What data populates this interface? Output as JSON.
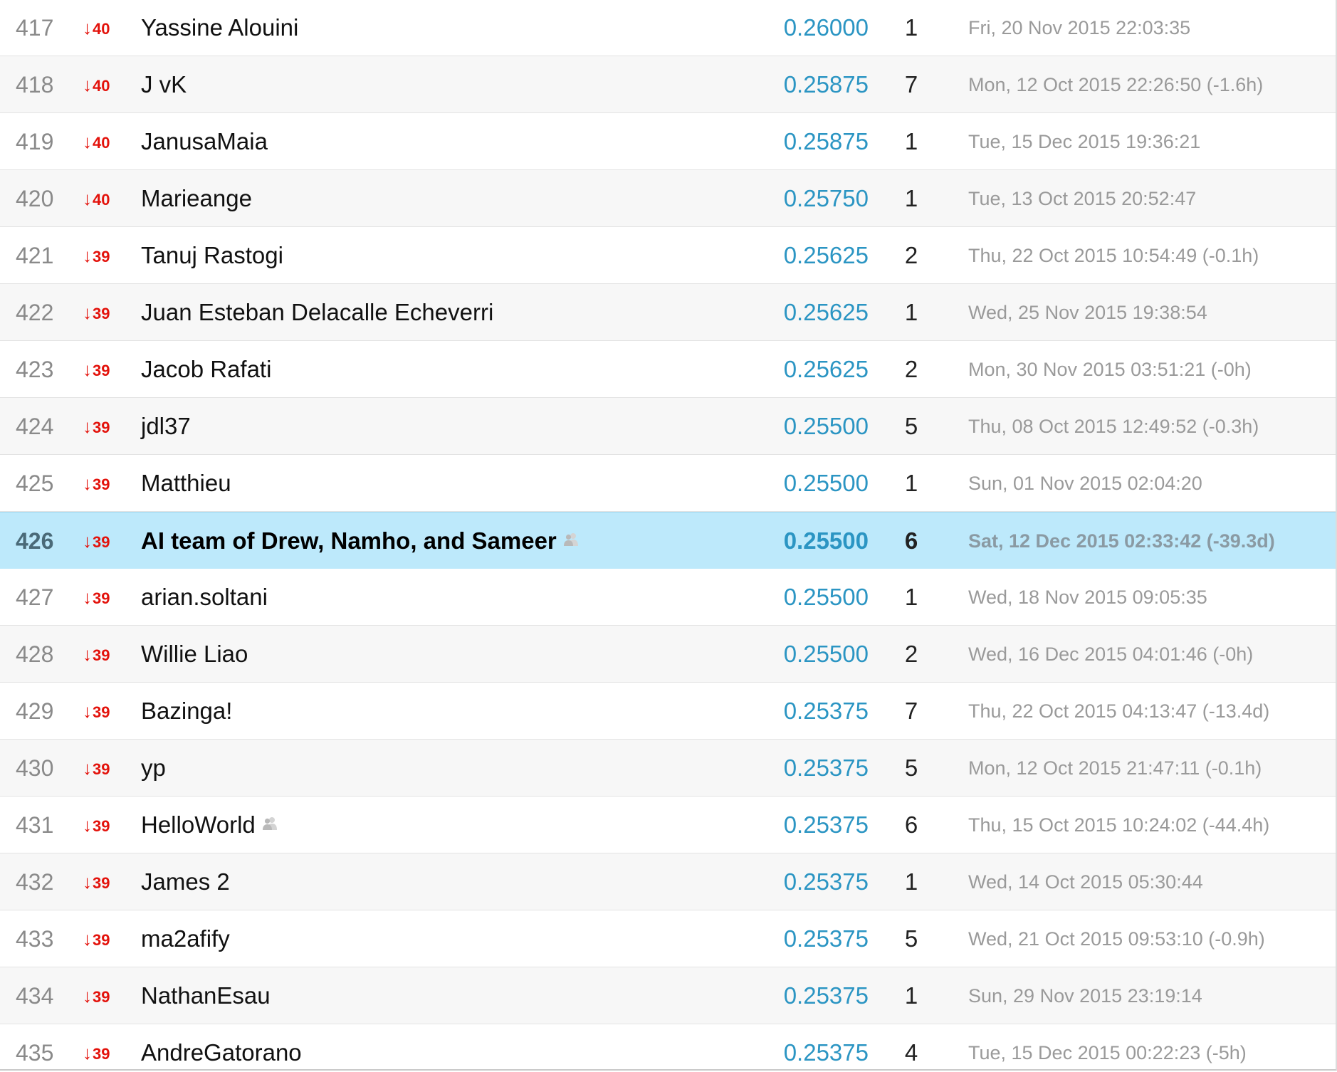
{
  "rows": [
    {
      "rank": "417",
      "change": "40",
      "team": "Yassine Alouini",
      "score": "0.26000",
      "entries": "1",
      "last": "Fri, 20 Nov 2015 22:03:35",
      "team_icon": false,
      "highlight": false
    },
    {
      "rank": "418",
      "change": "40",
      "team": "J vK",
      "score": "0.25875",
      "entries": "7",
      "last": "Mon, 12 Oct 2015 22:26:50 (-1.6h)",
      "team_icon": false,
      "highlight": false
    },
    {
      "rank": "419",
      "change": "40",
      "team": "JanusaMaia",
      "score": "0.25875",
      "entries": "1",
      "last": "Tue, 15 Dec 2015 19:36:21",
      "team_icon": false,
      "highlight": false
    },
    {
      "rank": "420",
      "change": "40",
      "team": "Marieange",
      "score": "0.25750",
      "entries": "1",
      "last": "Tue, 13 Oct 2015 20:52:47",
      "team_icon": false,
      "highlight": false
    },
    {
      "rank": "421",
      "change": "39",
      "team": "Tanuj Rastogi",
      "score": "0.25625",
      "entries": "2",
      "last": "Thu, 22 Oct 2015 10:54:49 (-0.1h)",
      "team_icon": false,
      "highlight": false
    },
    {
      "rank": "422",
      "change": "39",
      "team": "Juan Esteban Delacalle Echeverri",
      "score": "0.25625",
      "entries": "1",
      "last": "Wed, 25 Nov 2015 19:38:54",
      "team_icon": false,
      "highlight": false
    },
    {
      "rank": "423",
      "change": "39",
      "team": "Jacob Rafati",
      "score": "0.25625",
      "entries": "2",
      "last": "Mon, 30 Nov 2015 03:51:21 (-0h)",
      "team_icon": false,
      "highlight": false
    },
    {
      "rank": "424",
      "change": "39",
      "team": "jdl37",
      "score": "0.25500",
      "entries": "5",
      "last": "Thu, 08 Oct 2015 12:49:52 (-0.3h)",
      "team_icon": false,
      "highlight": false
    },
    {
      "rank": "425",
      "change": "39",
      "team": "Matthieu",
      "score": "0.25500",
      "entries": "1",
      "last": "Sun, 01 Nov 2015 02:04:20",
      "team_icon": false,
      "highlight": false
    },
    {
      "rank": "426",
      "change": "39",
      "team": "AI team of Drew, Namho, and Sameer",
      "score": "0.25500",
      "entries": "6",
      "last": "Sat, 12 Dec 2015 02:33:42 (-39.3d)",
      "team_icon": true,
      "highlight": true
    },
    {
      "rank": "427",
      "change": "39",
      "team": "arian.soltani",
      "score": "0.25500",
      "entries": "1",
      "last": "Wed, 18 Nov 2015 09:05:35",
      "team_icon": false,
      "highlight": false
    },
    {
      "rank": "428",
      "change": "39",
      "team": "Willie Liao",
      "score": "0.25500",
      "entries": "2",
      "last": "Wed, 16 Dec 2015 04:01:46 (-0h)",
      "team_icon": false,
      "highlight": false
    },
    {
      "rank": "429",
      "change": "39",
      "team": "Bazinga!",
      "score": "0.25375",
      "entries": "7",
      "last": "Thu, 22 Oct 2015 04:13:47 (-13.4d)",
      "team_icon": false,
      "highlight": false
    },
    {
      "rank": "430",
      "change": "39",
      "team": "yp",
      "score": "0.25375",
      "entries": "5",
      "last": "Mon, 12 Oct 2015 21:47:11 (-0.1h)",
      "team_icon": false,
      "highlight": false
    },
    {
      "rank": "431",
      "change": "39",
      "team": "HelloWorld",
      "score": "0.25375",
      "entries": "6",
      "last": "Thu, 15 Oct 2015 10:24:02 (-44.4h)",
      "team_icon": true,
      "highlight": false
    },
    {
      "rank": "432",
      "change": "39",
      "team": "James 2",
      "score": "0.25375",
      "entries": "1",
      "last": "Wed, 14 Oct 2015 05:30:44",
      "team_icon": false,
      "highlight": false
    },
    {
      "rank": "433",
      "change": "39",
      "team": "ma2afify",
      "score": "0.25375",
      "entries": "5",
      "last": "Wed, 21 Oct 2015 09:53:10 (-0.9h)",
      "team_icon": false,
      "highlight": false
    },
    {
      "rank": "434",
      "change": "39",
      "team": "NathanEsau",
      "score": "0.25375",
      "entries": "1",
      "last": "Sun, 29 Nov 2015 23:19:14",
      "team_icon": false,
      "highlight": false
    },
    {
      "rank": "435",
      "change": "39",
      "team": "AndreGatorano",
      "score": "0.25375",
      "entries": "4",
      "last": "Tue, 15 Dec 2015 00:22:23 (-5h)",
      "team_icon": false,
      "highlight": false
    }
  ],
  "icons": {
    "change_arrow": "↓",
    "team_icon": "team-members-icon"
  },
  "colors": {
    "rank_change": "#e3120b",
    "score": "#2b95c3",
    "highlight_row": "#bde9fb",
    "alt_row": "#f7f7f7"
  }
}
